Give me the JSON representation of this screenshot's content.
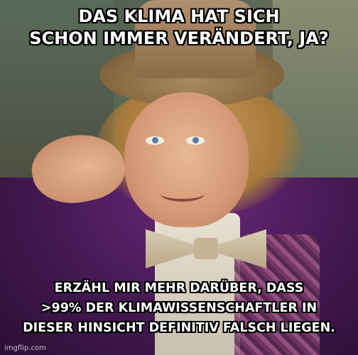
{
  "meme": {
    "top_text": [
      "DAS KLIMA HAT SICH",
      "SCHON IMMER VERÄNDERT, JA?"
    ],
    "bottom_text": [
      "ERZÄHL MIR MEHR DARÜBER, DASS",
      ">99% DER KLIMAWISSENSCHAFTLER IN",
      "DIESER HINSICHT DEFINITIV FALSCH LIEGEN."
    ],
    "watermark": "imgflip.com"
  }
}
